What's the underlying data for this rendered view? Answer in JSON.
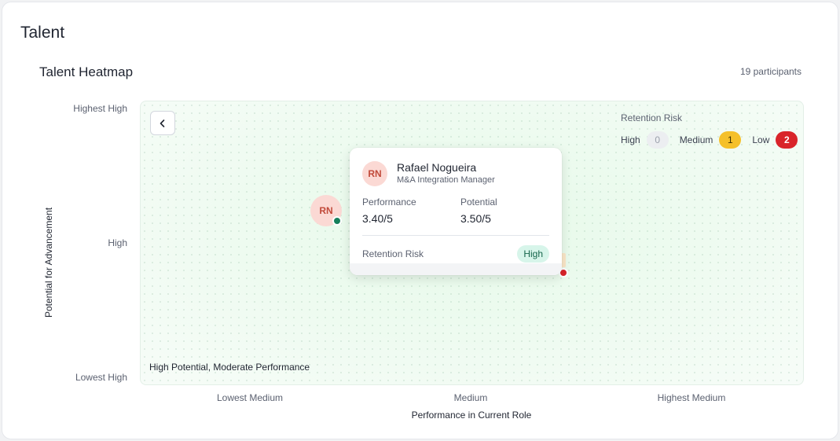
{
  "page": {
    "title": "Talent"
  },
  "heatmap": {
    "title": "Talent Heatmap",
    "participants": "19 participants",
    "y_axis": {
      "label": "Potential for Advancement",
      "ticks": [
        "Highest High",
        "High",
        "Lowest High"
      ]
    },
    "x_axis": {
      "label": "Performance in Current Role",
      "ticks": [
        "Lowest Medium",
        "Medium",
        "Highest Medium"
      ]
    },
    "quadrant_label": "High Potential, Moderate Performance",
    "legend": {
      "title": "Retention Risk",
      "items": [
        {
          "label": "High",
          "count": "0",
          "color": "#eceef1"
        },
        {
          "label": "Medium",
          "count": "1",
          "color": "#f5c02a"
        },
        {
          "label": "Low",
          "count": "2",
          "color": "#d9242a"
        }
      ]
    },
    "bubble": {
      "initials": "RN",
      "status_color": "#16805c"
    },
    "tooltip": {
      "initials": "RN",
      "name": "Rafael Nogueira",
      "role": "M&A Integration Manager",
      "performance_label": "Performance",
      "performance_value": "3.40/5",
      "potential_label": "Potential",
      "potential_value": "3.50/5",
      "retention_label": "Retention Risk",
      "retention_value": "High"
    }
  },
  "icons": {
    "back": "chevron-left-icon"
  }
}
